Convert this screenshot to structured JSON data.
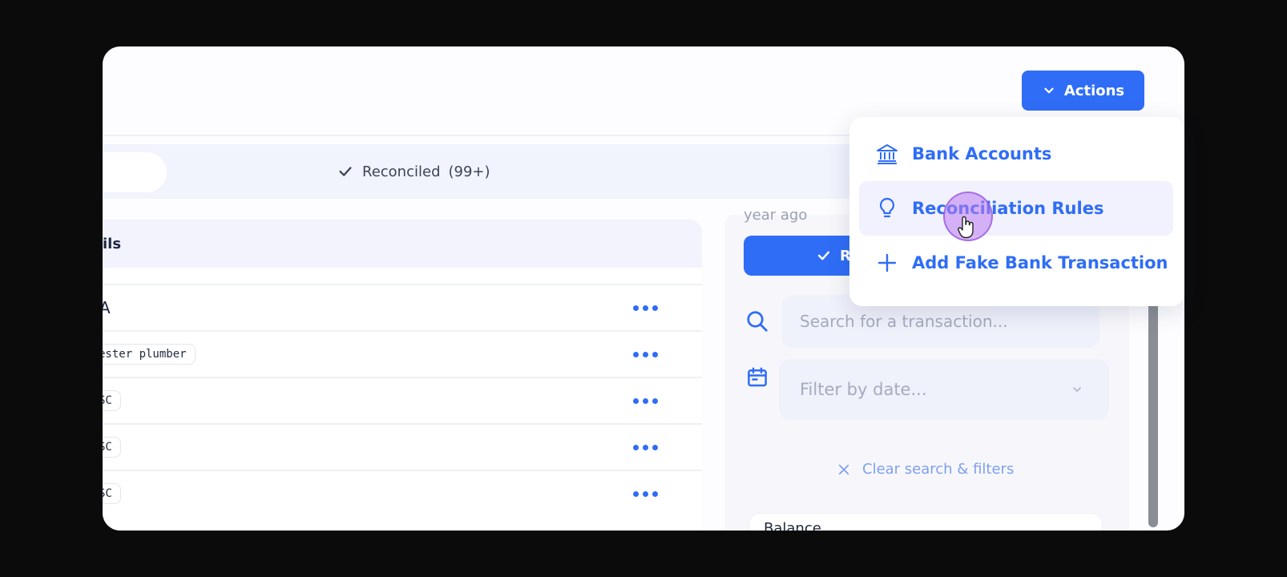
{
  "header": {
    "actions_label": "Actions"
  },
  "tabs": {
    "reconciled_label": "Reconciled",
    "reconciled_count": "(99+)"
  },
  "table": {
    "header_label": "ils",
    "rows": [
      {
        "text": "A",
        "kind": "plain"
      },
      {
        "text": "ester plumber",
        "kind": "tag"
      },
      {
        "text": "SC",
        "kind": "tag"
      },
      {
        "text": "SC",
        "kind": "tag"
      },
      {
        "text": "SC",
        "kind": "tag"
      }
    ]
  },
  "side_panel": {
    "faded_text": "year ago",
    "button_label": "R",
    "search_placeholder": "Search for a transaction...",
    "date_placeholder": "Filter by date...",
    "clear_label": "Clear search & filters",
    "balance_label": "Balance"
  },
  "actions_menu": {
    "items": [
      {
        "label": "Bank Accounts",
        "icon": "bank-icon"
      },
      {
        "label": "Reconciliation Rules",
        "icon": "lightbulb-icon"
      },
      {
        "label": "Add Fake Bank Transaction",
        "icon": "plus-icon"
      }
    ]
  },
  "colors": {
    "accent": "#2f6df6",
    "menu_hover": "#f1f2fd",
    "cursor_ring": "#bb7af0"
  }
}
